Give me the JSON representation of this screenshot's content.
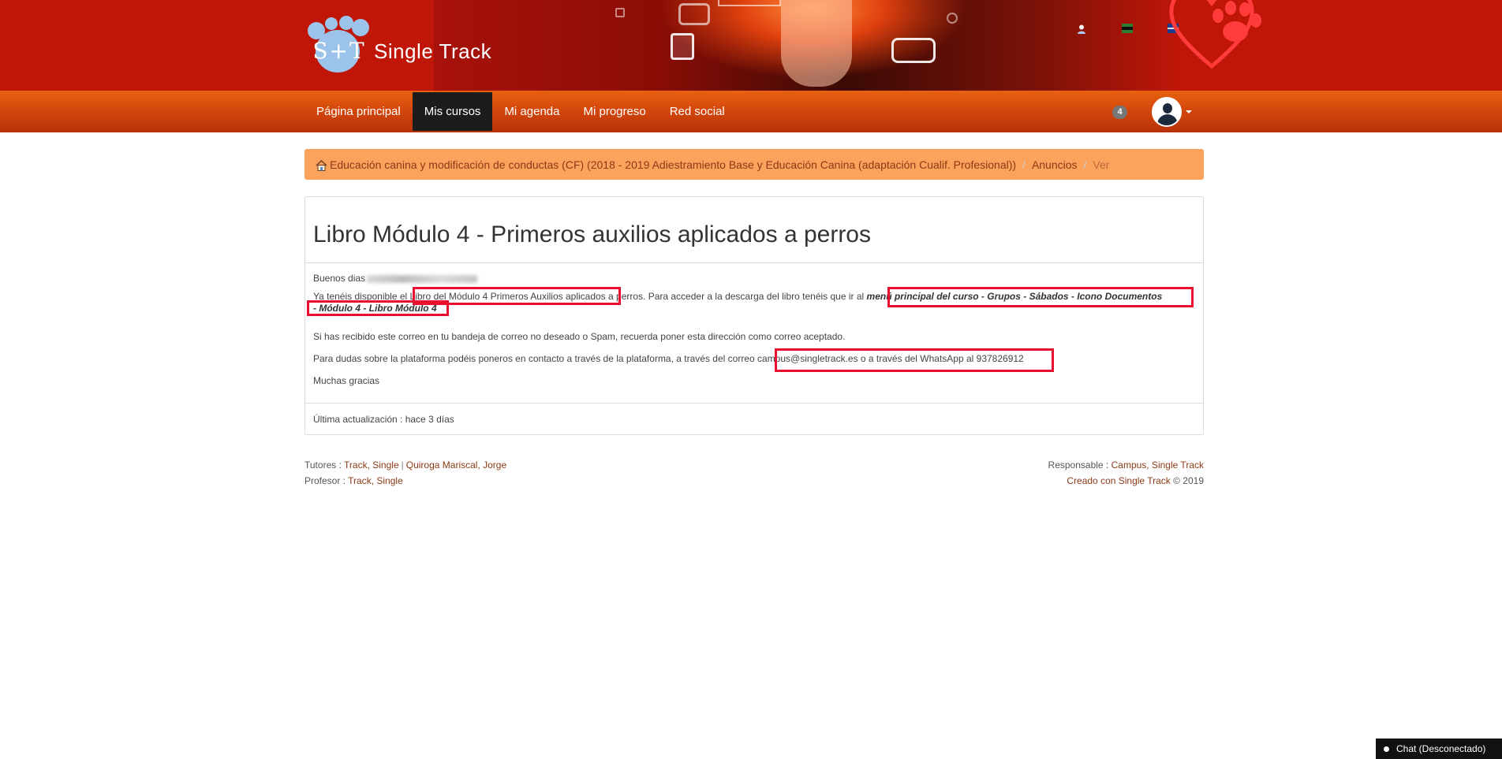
{
  "header": {
    "logo_mark": "S+T",
    "logo_text": "Single Track",
    "top_icons": [
      "user-icon",
      "flag-es-icon",
      "flag-en-icon"
    ]
  },
  "nav": {
    "items": [
      {
        "label": "Página principal",
        "active": false
      },
      {
        "label": "Mis cursos",
        "active": true
      },
      {
        "label": "Mi agenda",
        "active": false
      },
      {
        "label": "Mi progreso",
        "active": false
      },
      {
        "label": "Red social",
        "active": false
      }
    ],
    "notification_count": "4"
  },
  "breadcrumb": {
    "course": "Educación canina y modificación de conductas (CF) (2018 - 2019 Adiestramiento Base y Educación Canina (adaptación Cualif. Profesional))",
    "section": "Anuncios",
    "current": "Ver",
    "separator": "/"
  },
  "announcement": {
    "title": "Libro Módulo 4 - Primeros auxilios aplicados a perros",
    "greeting": "Buenos dias",
    "para1_a": "Ya tenéis disponible el",
    "para1_b": "Libro del Módulo 4 Primeros Auxilios aplicados a perros",
    "para1_c": ". Para acceder a la descarga del libro tenéis que ir al",
    "para1_d": "menú principal del curso - Grupos - Sábados - Icono Documentos",
    "para1_e": "- Módulo 4 - Libro Módulo 4",
    "para2": "Si has recibido este correo en tu bandeja de correo no deseado o Spam, recuerda poner esta dirección como correo aceptado.",
    "para3_a": "Para dudas sobre la plataforma podéis poneros en contacto a través de la plataforma, a través del correo",
    "para3_b": "campus@singletrack.es o a través del WhatsApp al 937826912",
    "para4": "Muchas gracias",
    "last_update": "Última actualización : hace 3 días"
  },
  "footer": {
    "tutores_label": "Tutores :",
    "tutor1": "Track, Single",
    "tutor2": "Quiroga Mariscal, Jorge",
    "profesor_label": "Profesor :",
    "profesor": "Track, Single",
    "responsable_label": "Responsable :",
    "responsable": "Campus, Single Track",
    "created": "Creado con Single Track",
    "copyright": "© 2019"
  },
  "chat": {
    "label": "Chat (Desconectado)"
  },
  "colors": {
    "banner": "#c01608",
    "navbar": "#d4480c",
    "breadcrumb_bg": "#fba25c",
    "highlight": "#e8102e",
    "link": "#8b3a16"
  }
}
